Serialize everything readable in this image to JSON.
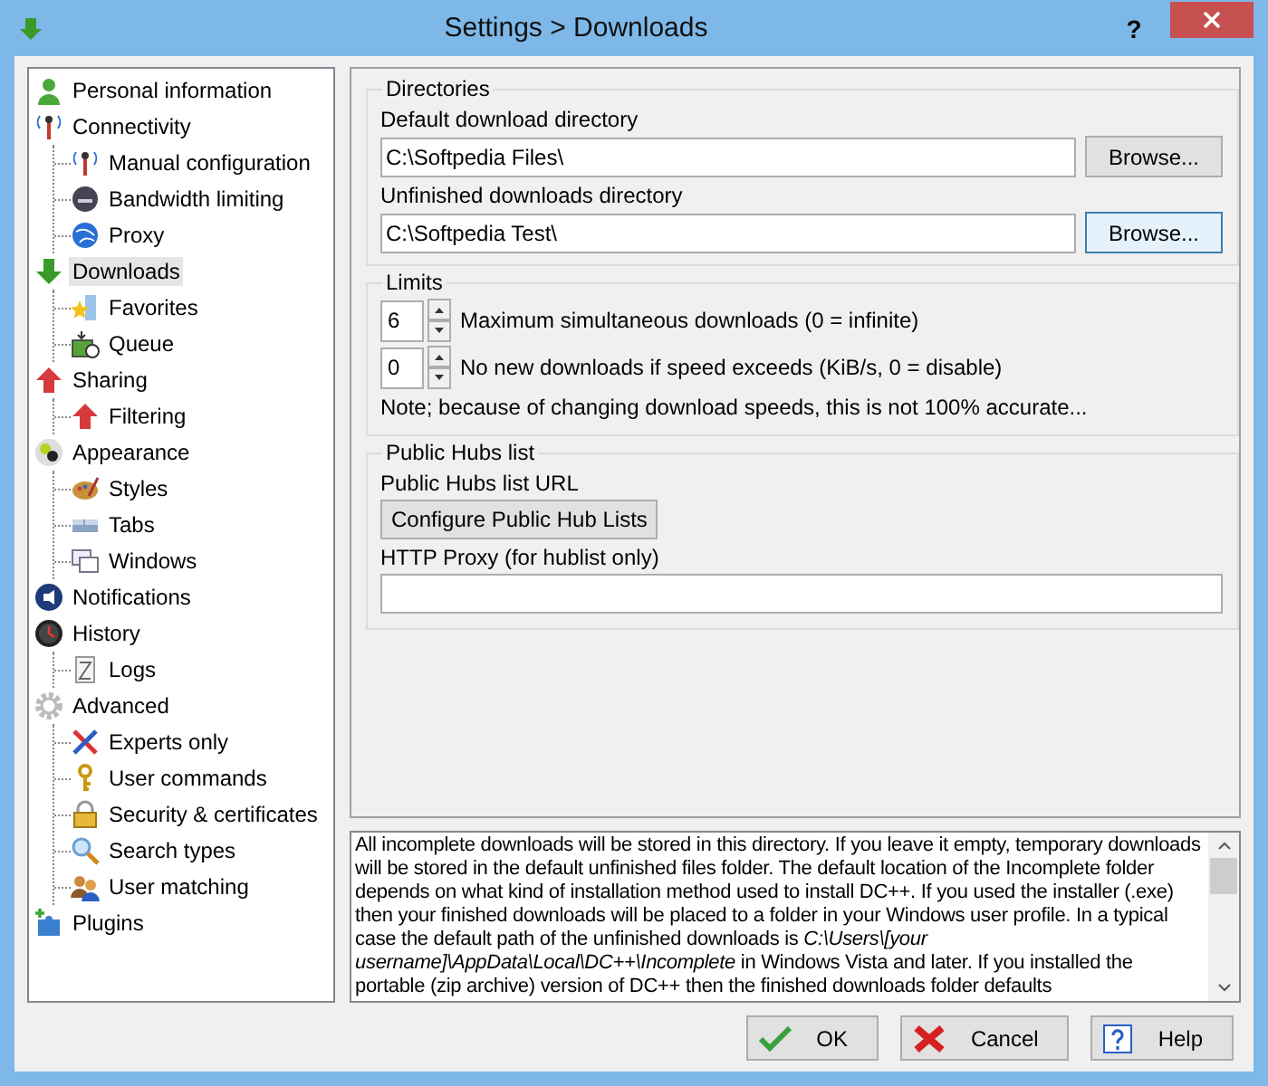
{
  "window": {
    "title": "Settings > Downloads",
    "help": "?"
  },
  "tree": [
    {
      "label": "Personal information",
      "selected": false
    },
    {
      "label": "Connectivity",
      "selected": false,
      "children": [
        {
          "label": "Manual configuration",
          "selected": false
        },
        {
          "label": "Bandwidth limiting",
          "selected": false
        },
        {
          "label": "Proxy",
          "selected": false
        }
      ]
    },
    {
      "label": "Downloads",
      "selected": true,
      "children": [
        {
          "label": "Favorites",
          "selected": false
        },
        {
          "label": "Queue",
          "selected": false
        }
      ]
    },
    {
      "label": "Sharing",
      "selected": false,
      "children": [
        {
          "label": "Filtering",
          "selected": false
        }
      ]
    },
    {
      "label": "Appearance",
      "selected": false,
      "children": [
        {
          "label": "Styles",
          "selected": false
        },
        {
          "label": "Tabs",
          "selected": false
        },
        {
          "label": "Windows",
          "selected": false
        }
      ]
    },
    {
      "label": "Notifications",
      "selected": false
    },
    {
      "label": "History",
      "selected": false,
      "children": [
        {
          "label": "Logs",
          "selected": false
        }
      ]
    },
    {
      "label": "Advanced",
      "selected": false,
      "children": [
        {
          "label": "Experts only",
          "selected": false
        },
        {
          "label": "User commands",
          "selected": false
        },
        {
          "label": "Security & certificates",
          "selected": false
        },
        {
          "label": "Search types",
          "selected": false
        },
        {
          "label": "User matching",
          "selected": false
        }
      ]
    },
    {
      "label": "Plugins",
      "selected": false
    }
  ],
  "directories": {
    "title": "Directories",
    "fields": [
      {
        "label": "Default download directory",
        "value": "C:\\Softpedia Files\\",
        "button": "Browse...",
        "focused": false
      },
      {
        "label": "Unfinished downloads directory",
        "value": "C:\\Softpedia Test\\",
        "button": "Browse...",
        "focused": true
      }
    ]
  },
  "limits": {
    "title": "Limits",
    "spinners": [
      {
        "value": "6",
        "label": "Maximum simultaneous downloads (0 = infinite)"
      },
      {
        "value": "0",
        "label": "No new downloads if speed exceeds (KiB/s, 0 = disable)"
      }
    ],
    "note": "Note; because of changing download speeds, this is not 100% accurate..."
  },
  "public_hubs": {
    "title": "Public Hubs list",
    "url_label": "Public Hubs list URL",
    "configure_button": "Configure Public Hub Lists",
    "proxy_label": "HTTP Proxy (for hublist only)"
  },
  "description": "All incomplete downloads will be stored in this directory. If you leave it empty, temporary downloads will be stored in the default unfinished files folder. The default location of the Incomplete folder depends on what kind of installation method used to install DC++. If you used the installer (.exe) then your finished downloads will be placed to a folder in your Windows user profile. In a typical case the default path of the unfinished downloads is *C:\\Users\\[your username]\\AppData\\Local\\DC++\\Incomplete* in Windows Vista and later. If you installed the portable (zip archive) version of DC++ then the finished downloads folder defaults",
  "buttons": [
    {
      "label": "OK",
      "kind": "ok"
    },
    {
      "label": "Cancel",
      "kind": "cancel"
    },
    {
      "label": "Help",
      "kind": "help"
    }
  ]
}
